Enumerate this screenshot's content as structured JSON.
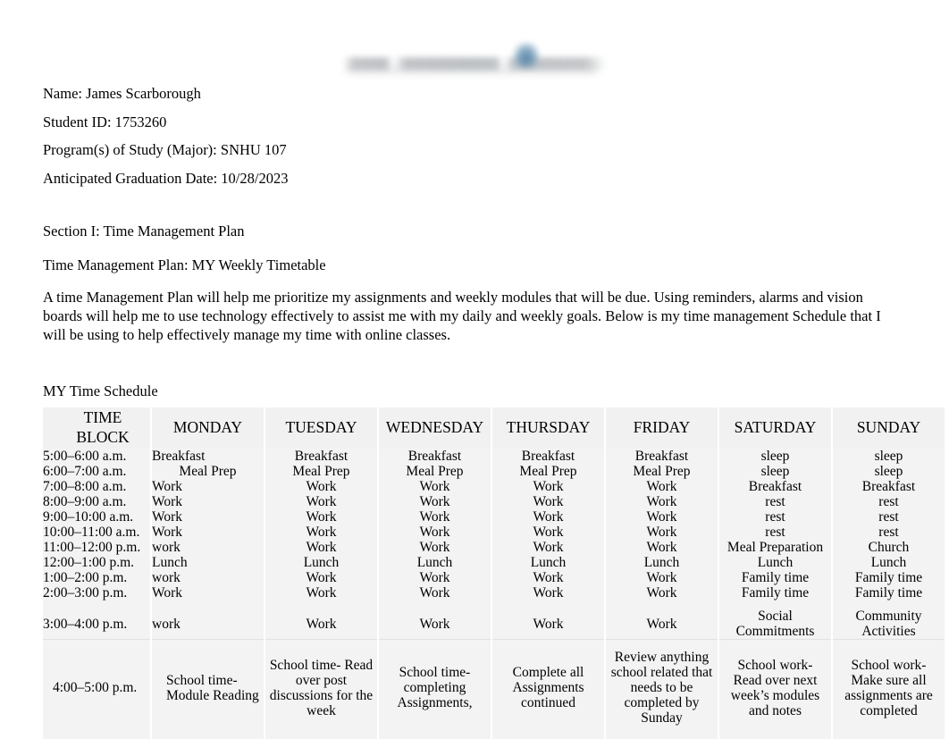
{
  "document": {
    "logo_alt": "university-logo-blurred",
    "header_fields": [
      "Name: James Scarborough",
      "Student ID: 1753260",
      "Program(s) of Study (Major): SNHU 107",
      "Anticipated Graduation Date: 10/28/2023"
    ],
    "section_title": "Section I: Time Management Plan",
    "subtitle": "Time Management Plan: MY Weekly Timetable",
    "paragraph": "A time Management Plan will help me prioritize my assignments and weekly modules that will be due. Using reminders, alarms and vision boards will help me to use technology effectively to assist me with my daily and weekly goals. Below is my time management Schedule that I will be using to help effectively manage my time with online classes.",
    "schedule_label": "MY Time Schedule"
  },
  "table": {
    "columns": [
      "TIME BLOCK",
      "MONDAY",
      "TUESDAY",
      "WEDNESDAY",
      "THURSDAY",
      "FRIDAY",
      "SATURDAY",
      "SUNDAY"
    ],
    "rows": [
      {
        "time": "5:00–6:00 a.m.",
        "cells": [
          "Breakfast",
          "Breakfast",
          "Breakfast",
          "Breakfast",
          "Breakfast",
          "sleep",
          "sleep"
        ]
      },
      {
        "time": "6:00–7:00 a.m.",
        "cells": [
          "Meal Prep",
          "Meal Prep",
          "Meal Prep",
          "Meal Prep",
          "Meal Prep",
          "sleep",
          "sleep"
        ]
      },
      {
        "time": "7:00–8:00 a.m.",
        "cells": [
          "Work",
          "Work",
          "Work",
          "Work",
          "Work",
          "Breakfast",
          "Breakfast"
        ]
      },
      {
        "time": "8:00–9:00 a.m.",
        "cells": [
          "Work",
          "Work",
          "Work",
          "Work",
          "Work",
          "rest",
          "rest"
        ]
      },
      {
        "time": "9:00–10:00 a.m.",
        "cells": [
          "Work",
          "Work",
          "Work",
          "Work",
          "Work",
          "rest",
          "rest"
        ]
      },
      {
        "time": "10:00–11:00 a.m.",
        "cells": [
          "Work",
          "Work",
          "Work",
          "Work",
          "Work",
          "rest",
          "rest"
        ]
      },
      {
        "time": "11:00–12:00 p.m.",
        "cells": [
          "work",
          "Work",
          "Work",
          "Work",
          "Work",
          "Meal Preparation",
          "Church"
        ]
      },
      {
        "time": "12:00–1:00 p.m.",
        "cells": [
          "Lunch",
          "Lunch",
          "Lunch",
          "Lunch",
          "Lunch",
          "Lunch",
          "Lunch"
        ]
      },
      {
        "time": "1:00–2:00 p.m.",
        "cells": [
          "work",
          "Work",
          "Work",
          "Work",
          "Work",
          "Family time",
          "Family time"
        ]
      },
      {
        "time": "2:00–3:00 p.m.",
        "cells": [
          "Work",
          "Work",
          "Work",
          "Work",
          "Work",
          "Family time",
          "Family time"
        ]
      },
      {
        "time": "3:00–4:00 p.m.",
        "cells": [
          "work",
          "Work",
          "Work",
          "Work",
          "Work",
          "Social Commitments",
          "Community Activities"
        ]
      },
      {
        "time": "4:00–5:00 p.m.",
        "cells": [
          "School time- Module Reading",
          "School time- Read over post discussions for the week",
          "School time- completing Assignments,",
          "Complete all Assignments continued",
          "Review anything school related that needs to be completed by Sunday",
          "School work- Read over   next week’s modules and notes",
          "School work- Make sure all assignments are completed"
        ]
      }
    ]
  }
}
